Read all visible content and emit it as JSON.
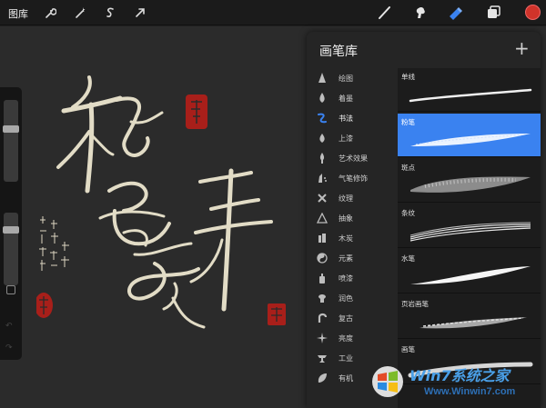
{
  "toolbar": {
    "gallery_label": "图库",
    "left_tools": [
      {
        "name": "wrench-icon"
      },
      {
        "name": "magic-wand-icon"
      },
      {
        "name": "selection-icon"
      },
      {
        "name": "transform-arrow-icon"
      }
    ],
    "right_tools": [
      {
        "name": "brush-icon"
      },
      {
        "name": "smudge-icon"
      },
      {
        "name": "eraser-icon",
        "active": true
      },
      {
        "name": "layers-icon"
      }
    ],
    "current_color": "#d0332a"
  },
  "panel": {
    "title": "画笔库",
    "add_label": "+",
    "categories": [
      {
        "label": "绘图",
        "icon": "pencil-tip-icon"
      },
      {
        "label": "着墨",
        "icon": "ink-drop-icon"
      },
      {
        "label": "书法",
        "icon": "calligraphy-icon",
        "active": true
      },
      {
        "label": "上漆",
        "icon": "paint-drop-icon"
      },
      {
        "label": "艺术效果",
        "icon": "art-brush-icon"
      },
      {
        "label": "气笔修饰",
        "icon": "airbrush-icon"
      },
      {
        "label": "纹理",
        "icon": "texture-icon"
      },
      {
        "label": "抽象",
        "icon": "triangle-icon"
      },
      {
        "label": "木炭",
        "icon": "charcoal-icon"
      },
      {
        "label": "元素",
        "icon": "yin-yang-icon"
      },
      {
        "label": "喷漆",
        "icon": "spray-can-icon"
      },
      {
        "label": "润色",
        "icon": "retouch-icon"
      },
      {
        "label": "复古",
        "icon": "retro-icon"
      },
      {
        "label": "亮度",
        "icon": "sparkle-icon"
      },
      {
        "label": "工业",
        "icon": "anvil-icon"
      },
      {
        "label": "有机",
        "icon": "leaf-icon"
      }
    ],
    "brushes": [
      {
        "name": "单线",
        "selected": false
      },
      {
        "name": "粉笔",
        "selected": true
      },
      {
        "name": "斑点",
        "selected": false
      },
      {
        "name": "条纹",
        "selected": false
      },
      {
        "name": "水笔",
        "selected": false
      },
      {
        "name": "页岩画笔",
        "selected": false
      },
      {
        "name": "画笔",
        "selected": false
      }
    ]
  },
  "watermark": {
    "title": "Win7系统之家",
    "url": "Www.Winwin7.com"
  },
  "colors": {
    "accent": "#3a82f0",
    "seal_red": "#b8211c"
  }
}
